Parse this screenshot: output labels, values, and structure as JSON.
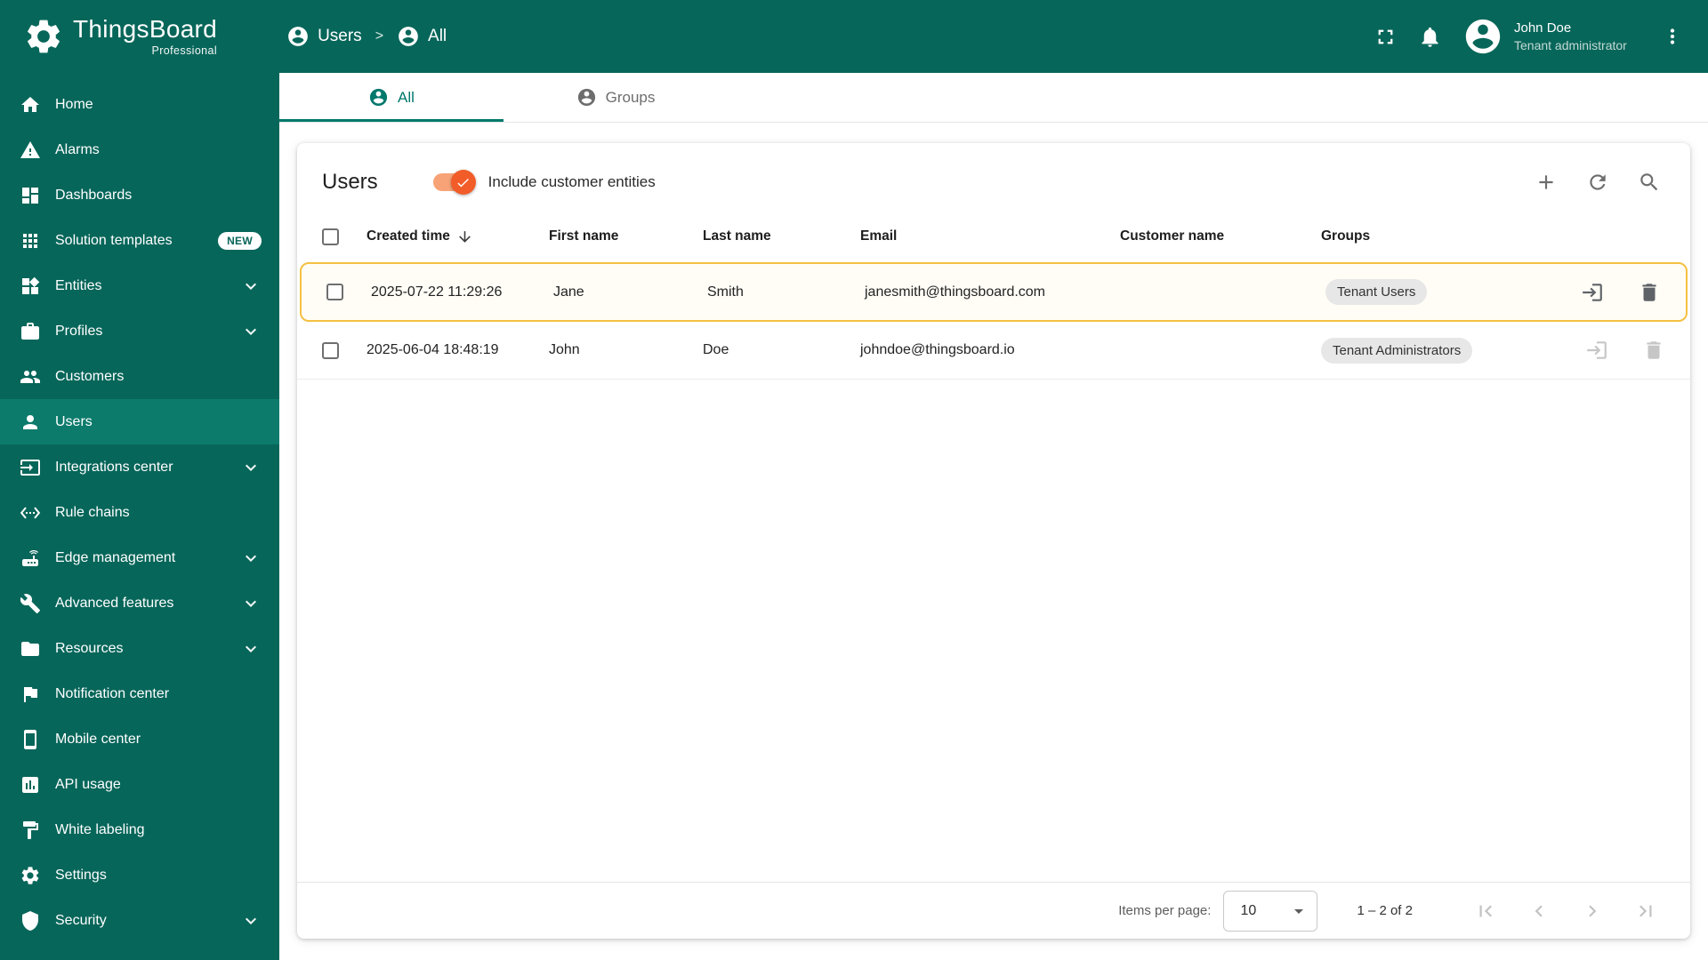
{
  "app": {
    "brand": "ThingsBoard",
    "brand_sub": "Professional"
  },
  "header": {
    "breadcrumb": [
      {
        "label": "Users",
        "icon": "account-circle-icon"
      },
      {
        "label": "All",
        "icon": "account-circle-icon"
      }
    ],
    "actions": [
      {
        "name": "fullscreen",
        "icon": "fullscreen-icon"
      },
      {
        "name": "notifications",
        "icon": "bell-icon"
      }
    ],
    "user": {
      "name": "John Doe",
      "role": "Tenant administrator",
      "avatar_icon": "account-circle-icon",
      "menu_icon": "more-vert-icon"
    }
  },
  "sidebar": {
    "items": [
      {
        "label": "Home",
        "icon": "home-icon"
      },
      {
        "label": "Alarms",
        "icon": "alarms-icon"
      },
      {
        "label": "Dashboards",
        "icon": "dashboards-icon"
      },
      {
        "label": "Solution templates",
        "icon": "solution-templates-icon",
        "badge": "NEW"
      },
      {
        "label": "Entities",
        "icon": "entities-icon",
        "expandable": true
      },
      {
        "label": "Profiles",
        "icon": "profiles-icon",
        "expandable": true
      },
      {
        "label": "Customers",
        "icon": "customers-icon"
      },
      {
        "label": "Users",
        "icon": "users-icon",
        "active": true
      },
      {
        "label": "Integrations center",
        "icon": "integrations-icon",
        "expandable": true
      },
      {
        "label": "Rule chains",
        "icon": "rule-chains-icon"
      },
      {
        "label": "Edge management",
        "icon": "edge-management-icon",
        "expandable": true
      },
      {
        "label": "Advanced features",
        "icon": "advanced-features-icon",
        "expandable": true
      },
      {
        "label": "Resources",
        "icon": "resources-icon",
        "expandable": true
      },
      {
        "label": "Notification center",
        "icon": "notification-center-icon"
      },
      {
        "label": "Mobile center",
        "icon": "mobile-center-icon"
      },
      {
        "label": "API usage",
        "icon": "api-usage-icon"
      },
      {
        "label": "White labeling",
        "icon": "white-labeling-icon"
      },
      {
        "label": "Settings",
        "icon": "settings-icon"
      },
      {
        "label": "Security",
        "icon": "security-icon",
        "expandable": true
      }
    ]
  },
  "tabs": [
    {
      "label": "All",
      "icon": "account-circle-icon",
      "active": true
    },
    {
      "label": "Groups",
      "icon": "account-circle-icon",
      "active": false
    }
  ],
  "users_card": {
    "title": "Users",
    "toggle": {
      "label": "Include customer entities",
      "checked": true
    },
    "toolbar": [
      {
        "name": "add-user",
        "icon": "add-icon"
      },
      {
        "name": "refresh",
        "icon": "refresh-icon"
      },
      {
        "name": "search",
        "icon": "search-icon"
      }
    ],
    "columns": [
      {
        "label": "Created time",
        "sorted": "desc"
      },
      {
        "label": "First name"
      },
      {
        "label": "Last name"
      },
      {
        "label": "Email"
      },
      {
        "label": "Customer name"
      },
      {
        "label": "Groups"
      }
    ],
    "rows": [
      {
        "created_time": "2025-07-22 11:29:26",
        "first_name": "Jane",
        "last_name": "Smith",
        "email": "janesmith@thingsboard.com",
        "customer_name": "",
        "groups": [
          "Tenant Users"
        ],
        "highlighted": true,
        "actions_enabled": true
      },
      {
        "created_time": "2025-06-04 18:48:19",
        "first_name": "John",
        "last_name": "Doe",
        "email": "johndoe@thingsboard.io",
        "customer_name": "",
        "groups": [
          "Tenant Administrators"
        ],
        "highlighted": false,
        "actions_enabled": false
      }
    ],
    "pagination": {
      "items_per_page_label": "Items per page:",
      "items_per_page": "10",
      "range": "1 – 2 of 2",
      "controls": [
        {
          "name": "first-page",
          "icon": "first-page-icon",
          "disabled": true
        },
        {
          "name": "prev-page",
          "icon": "prev-page-icon",
          "disabled": true
        },
        {
          "name": "next-page",
          "icon": "next-page-icon",
          "disabled": true
        },
        {
          "name": "last-page",
          "icon": "last-page-icon",
          "disabled": true
        }
      ]
    }
  },
  "colors": {
    "primary_teal": "#07665a",
    "active_item_teal": "#0c7b6c",
    "tab_active_teal": "#00786c",
    "toggle_thumb_orange": "#f25c28",
    "toggle_track_orange": "#f8a377",
    "row_highlight_border": "#f5c042",
    "chip_background": "#e7e7e7"
  }
}
